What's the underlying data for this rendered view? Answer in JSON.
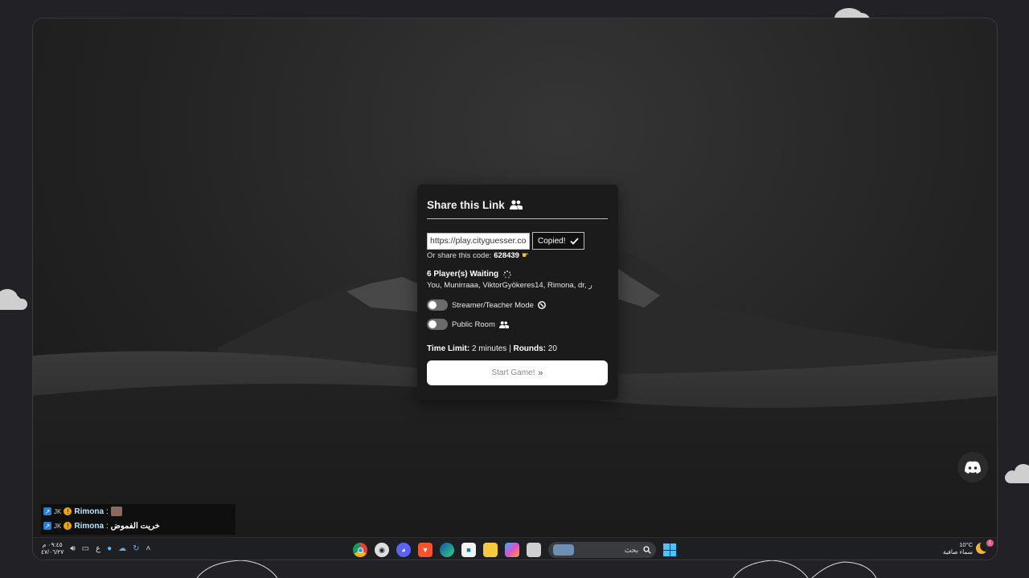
{
  "modal": {
    "title": "Share this Link",
    "link_value": "https://play.cityguesser.com",
    "copied_label": "Copied!",
    "share_code_prefix": "Or share this code:",
    "share_code": "628439",
    "waiting_label": "6 Player(s) Waiting",
    "players": "You, Munirraaa, ViktorGyökeres14, Rimona, dr, ر",
    "streamer_mode_label": "Streamer/Teacher Mode",
    "streamer_mode_on": false,
    "public_room_label": "Public Room",
    "public_room_on": false,
    "time_limit_label": "Time Limit:",
    "time_limit_value": "2 minutes",
    "rounds_label": "Rounds:",
    "rounds_value": "20",
    "start_label": "Start Game!"
  },
  "chat": {
    "messages": [
      {
        "user": "Rimona",
        "text": ""
      },
      {
        "user": "Rimona",
        "text": "خريت الفموض"
      }
    ]
  },
  "taskbar": {
    "time": "٠٩:٤٥ م",
    "date": "٤٧/٠٦/٢٧",
    "lang": "ع",
    "search_placeholder": "بحث",
    "temperature": "10°C",
    "weather": "سماء صافية",
    "notification_count": "1",
    "icons": [
      "chrome-icon",
      "obs-icon",
      "discord-icon",
      "brave-icon",
      "edge-icon",
      "store-icon",
      "file-explorer-icon",
      "copilot-icon",
      "window-icon"
    ]
  },
  "colors": {
    "background": "#222226",
    "modal_bg": "#1b1b1b",
    "accent_chat_user": "#b6e7ff",
    "windows_blue": "#4cc2ff"
  }
}
